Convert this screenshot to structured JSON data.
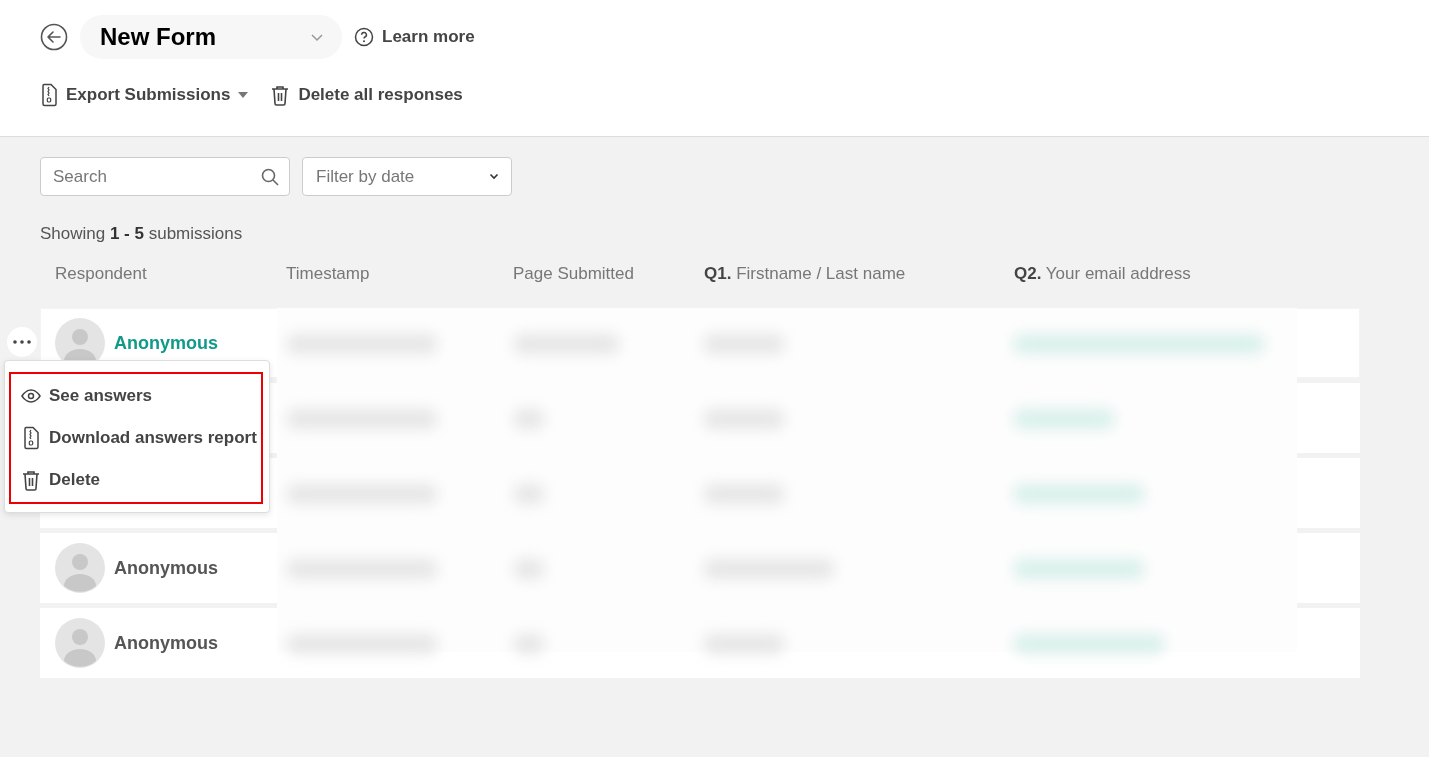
{
  "header": {
    "title": "New Form",
    "help_link": "Learn more"
  },
  "toolbar": [
    {
      "kind": "export",
      "label": "Export Submissions"
    },
    {
      "kind": "delete",
      "label": "Delete all responses"
    }
  ],
  "filters": {
    "search": {
      "placeholder": "Search"
    },
    "date": {
      "placeholder": "Filter by date"
    }
  },
  "summary": "Showing **1 - 5** submissions",
  "table": {
    "columns": [
      "Respondent",
      "Timestamp",
      "Page Submitted",
      "**Q1.** Firstname / Last name",
      "**Q2.** Your email address"
    ],
    "rows": [
      {
        "respondent": "Anonymous",
        "selected": true
      },
      {},
      {},
      {
        "respondent": "Anonymous",
        "selected": false
      },
      {
        "respondent": "Anonymous",
        "selected": false
      }
    ]
  },
  "row_menu": {
    "items": [
      {
        "kind": "view",
        "label": "See answers"
      },
      {
        "kind": "download",
        "label": "Download answers report"
      },
      {
        "kind": "delete",
        "label": "Delete"
      }
    ]
  }
}
